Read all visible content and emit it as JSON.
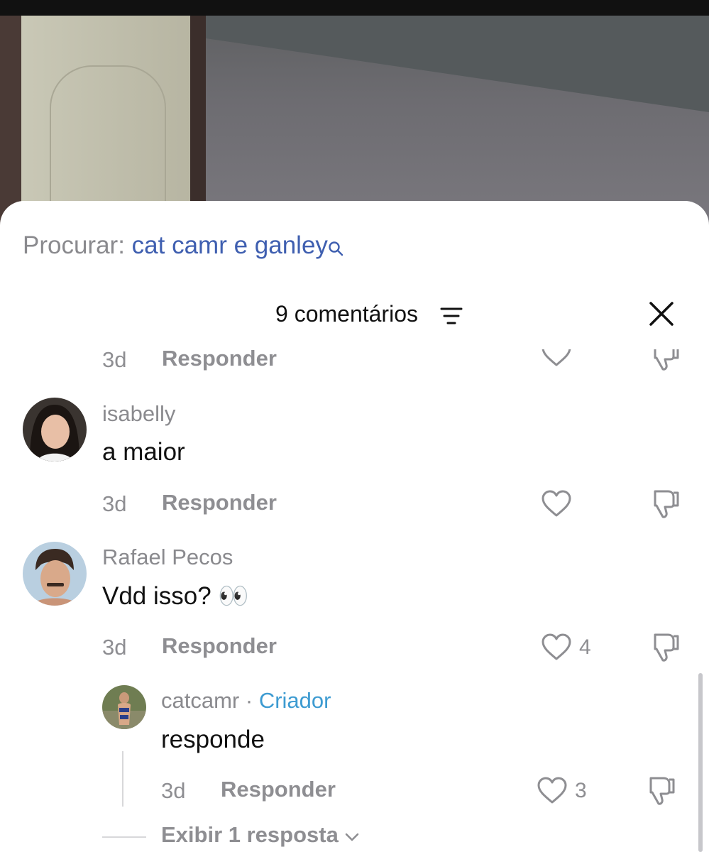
{
  "search": {
    "label": "Procurar:",
    "query": "cat camr e ganley"
  },
  "header": {
    "count_label": "9 comentários"
  },
  "comments": [
    {
      "time": "3d",
      "reply_label": "Responder"
    },
    {
      "username": "isabelly",
      "text": "a maior",
      "time": "3d",
      "reply_label": "Responder"
    },
    {
      "username": "Rafael Pecos",
      "text": "Vdd isso? 👀",
      "time": "3d",
      "reply_label": "Responder",
      "likes": "4",
      "replies": [
        {
          "username": "catcamr",
          "separator": "·",
          "badge": "Criador",
          "text": "responde",
          "time": "3d",
          "reply_label": "Responder",
          "likes": "3"
        }
      ],
      "more_replies_label": "Exibir 1 resposta"
    }
  ],
  "icons": [
    "search-icon",
    "sort-icon",
    "close-icon",
    "heart-icon",
    "dislike-icon",
    "chevron-down-icon"
  ],
  "colors": {
    "query": "#3f5fb0",
    "creator_badge": "#3d9bd1",
    "muted": "#8e8e92"
  }
}
